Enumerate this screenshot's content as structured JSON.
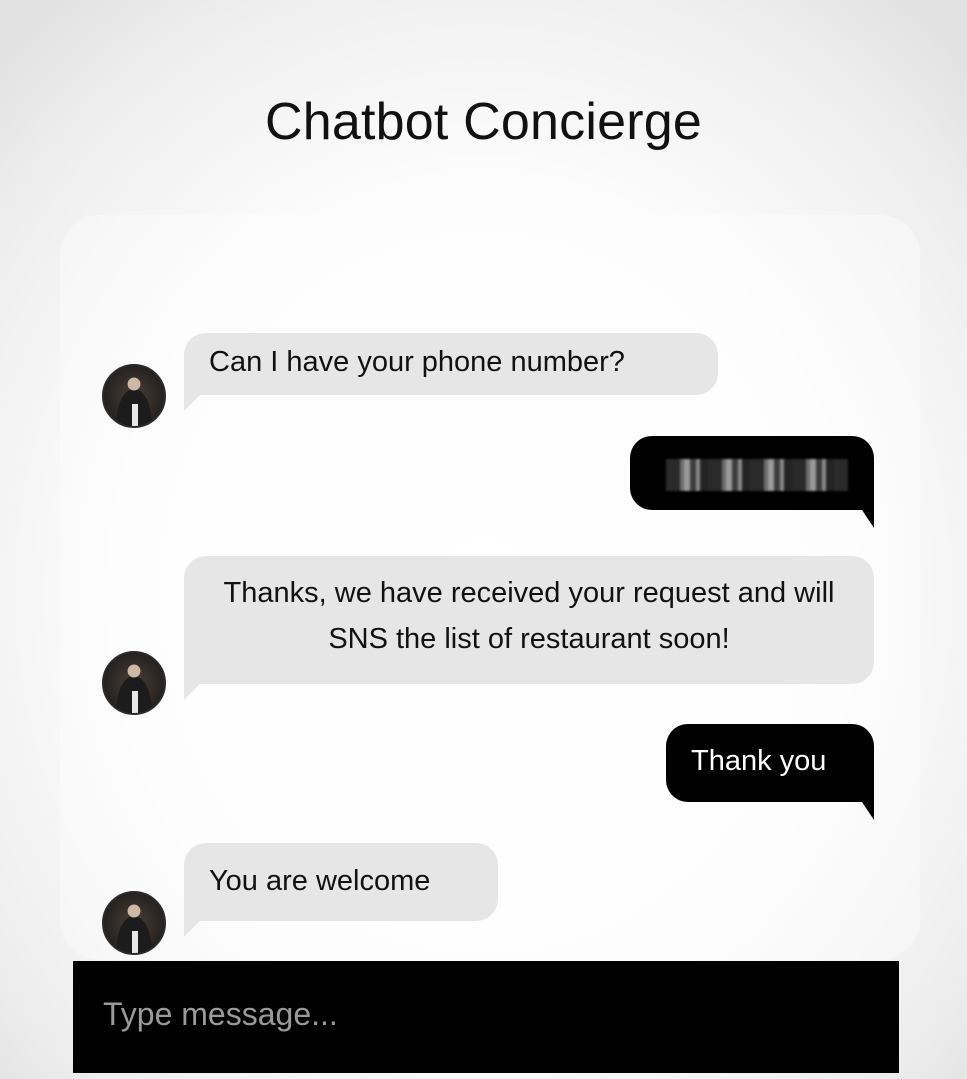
{
  "header": {
    "title": "Chatbot Concierge"
  },
  "messages": [
    {
      "sender": "bot",
      "text": "Can I have your phone number?"
    },
    {
      "sender": "user",
      "text": "",
      "redacted": true
    },
    {
      "sender": "bot",
      "text": "Thanks, we have received your request and will SNS the list of restaurant soon!"
    },
    {
      "sender": "user",
      "text": "Thank you"
    },
    {
      "sender": "bot",
      "text": "You are welcome"
    }
  ],
  "composer": {
    "placeholder": "Type message..."
  },
  "colors": {
    "bot_bubble": "#e6e6e6",
    "user_bubble": "#000000",
    "input_bar": "#000000"
  },
  "icons": {
    "bot_avatar": "bot-avatar-photo"
  }
}
